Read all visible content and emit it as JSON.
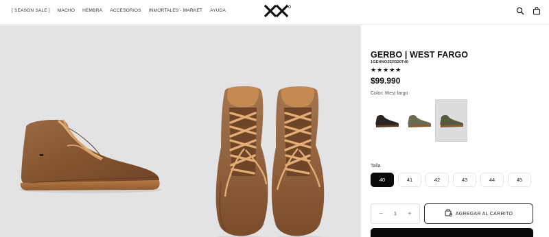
{
  "nav": {
    "items": [
      "[ SEASON SALE ]",
      "MACHO",
      "HEMBRA",
      "ACCESORIOS",
      "INMORTALES - MARKET",
      "AYUDA"
    ]
  },
  "header": {
    "logo_text": "XX",
    "icons": [
      "search-icon",
      "bag-icon"
    ]
  },
  "product": {
    "title": "GERBO | WEST FARGO",
    "sku": "1GEHNO2ER320T40",
    "rating_stars": "★★★★★",
    "price": "$99.990",
    "color_label": "Color:",
    "color_value": "West fargo",
    "swatches": [
      {
        "name": "black",
        "color": "#2a2522"
      },
      {
        "name": "olive",
        "color": "#6d6a52"
      },
      {
        "name": "green",
        "color": "#55573f"
      }
    ],
    "selected_swatch": 2
  },
  "size": {
    "label": "Talla",
    "options": [
      "40",
      "41",
      "42",
      "43",
      "44",
      "45"
    ],
    "selected": "40"
  },
  "cart": {
    "quantity": "1",
    "minus": "−",
    "plus": "+",
    "add_label": "AGREGAR AL CARRITO"
  },
  "colors": {
    "boot_brown": "#8a5a36",
    "laces": "#d9a26a",
    "background_gray": "#e3e3e5",
    "accent_black": "#0a0a0a"
  }
}
